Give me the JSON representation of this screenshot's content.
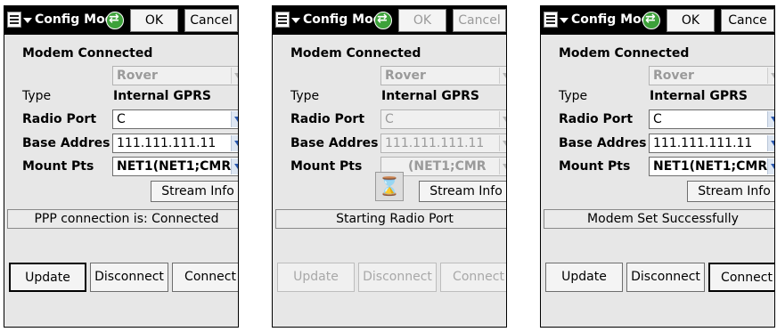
{
  "screens": [
    {
      "title": "Config  Mod",
      "ok": "OK",
      "cancel": "Cancel",
      "modem_connected": "Modem Connected",
      "mode": "Rover",
      "type_label": "Type",
      "type_value": "Internal GPRS",
      "radio_port_label": "Radio Port",
      "radio_port": "C",
      "base_address_label": "Base Addres",
      "base_address": "111.111.111.11",
      "mount_pts_label": "Mount Pts",
      "mount_pts": "NET1(NET1;CMR",
      "stream_info": "Stream Info",
      "status": "PPP connection is: Connected",
      "update": "Update",
      "disconnect": "Disconnect",
      "connect": "Connect"
    },
    {
      "title": "Config  Mod",
      "ok": "OK",
      "cancel": "Cancel",
      "modem_connected": "Modem Connected",
      "mode": "Rover",
      "type_label": "Type",
      "type_value": "Internal GPRS",
      "radio_port_label": "Radio Port",
      "radio_port": "C",
      "base_address_label": "Base Addres",
      "base_address": "111.111.111.11",
      "mount_pts_label": "Mount Pts",
      "mount_pts": "(NET1;CMR",
      "stream_info": "Stream Info",
      "status": "Starting Radio Port",
      "update": "Update",
      "disconnect": "Disconnect",
      "connect": "Connect"
    },
    {
      "title": "Config  Mod",
      "ok": "OK",
      "cancel": "Cance",
      "modem_connected": "Modem Connected",
      "mode": "Rover",
      "type_label": "Type",
      "type_value": "Internal GPRS",
      "radio_port_label": "Radio Port",
      "radio_port": "C",
      "base_address_label": "Base Addres",
      "base_address": "111.111.111.11",
      "mount_pts_label": "Mount Pts",
      "mount_pts": "NET1(NET1;CMR",
      "stream_info": "Stream Info",
      "status": "Modem Set Successfully",
      "update": "Update",
      "disconnect": "Disconnect",
      "connect": "Connect"
    }
  ]
}
